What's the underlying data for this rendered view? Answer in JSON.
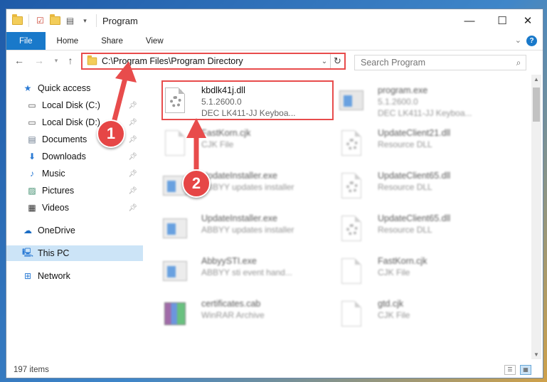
{
  "window": {
    "title": "Program",
    "minimize_glyph": "—",
    "maximize_glyph": "☐",
    "close_glyph": "✕"
  },
  "ribbon": {
    "tabs": [
      "File",
      "Home",
      "Share",
      "View"
    ],
    "help": "?"
  },
  "address_bar": {
    "path": "C:\\Program Files\\Program Directory"
  },
  "search": {
    "placeholder": "Search Program"
  },
  "sidebar": {
    "items": [
      {
        "label": "Quick access",
        "icon": "star-icon",
        "pinned": false
      },
      {
        "label": "Local Disk (C:)",
        "icon": "drive-icon",
        "pinned": true
      },
      {
        "label": "Local Disk (D:)",
        "icon": "drive-icon",
        "pinned": true
      },
      {
        "label": "Documents",
        "icon": "documents-icon",
        "pinned": true
      },
      {
        "label": "Downloads",
        "icon": "download-icon",
        "pinned": true
      },
      {
        "label": "Music",
        "icon": "music-icon",
        "pinned": true
      },
      {
        "label": "Pictures",
        "icon": "pictures-icon",
        "pinned": true
      },
      {
        "label": "Videos",
        "icon": "video-icon",
        "pinned": true
      },
      {
        "label": "OneDrive",
        "icon": "cloud-icon",
        "pinned": false
      },
      {
        "label": "This PC",
        "icon": "computer-icon",
        "pinned": false,
        "selected": true
      },
      {
        "label": "Network",
        "icon": "network-icon",
        "pinned": false
      }
    ]
  },
  "files": [
    {
      "name": "kbdlk41j.dll",
      "line2": "5.1.2600.0",
      "line3": "DEC LK411-JJ Keyboa...",
      "icon": "dll-gear-icon",
      "highlighted": true
    },
    {
      "name": "program.exe",
      "line2": "5.1.2600.0",
      "line3": "DEC LK411-JJ Keyboa...",
      "icon": "exe-icon"
    },
    {
      "name": "FastKorn.cjk",
      "line2": "CJK File",
      "icon": "generic-file-icon"
    },
    {
      "name": "UpdateClient21.dll",
      "line2": "Resource DLL",
      "icon": "dll-gear-icon"
    },
    {
      "name": "UpdateInstaller.exe",
      "line2": "ABBYY updates installer",
      "icon": "app-window-icon"
    },
    {
      "name": "UpdateClient65.dll",
      "line2": "Resource DLL",
      "icon": "dll-gear-icon"
    },
    {
      "name": "UpdateInstaller.exe",
      "line2": "ABBYY updates installer",
      "icon": "app-window-icon"
    },
    {
      "name": "UpdateClient65.dll",
      "line2": "Resource DLL",
      "icon": "dll-gear-icon"
    },
    {
      "name": "AbbyySTI.exe",
      "line2": "ABBYY sti event hand...",
      "icon": "app-window-icon"
    },
    {
      "name": "FastKorn.cjk",
      "line2": "CJK File",
      "icon": "generic-file-icon"
    },
    {
      "name": "certificates.cab",
      "line2": "WinRAR Archive",
      "icon": "winrar-icon"
    },
    {
      "name": "gtd.cjk",
      "line2": "CJK File",
      "icon": "generic-file-icon"
    }
  ],
  "status": {
    "item_count": "197 items"
  },
  "annotations": {
    "step1": "1",
    "step2": "2",
    "color": "#e84c4c"
  }
}
